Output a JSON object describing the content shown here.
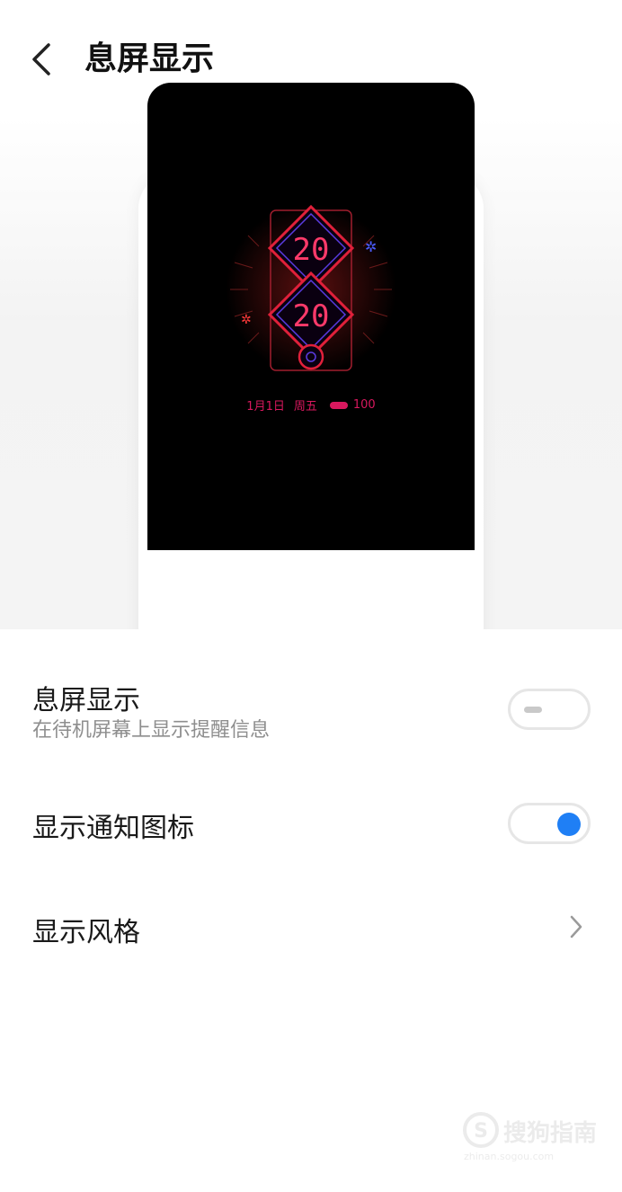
{
  "header": {
    "title": "息屏显示",
    "back_icon": "chevron-left-icon"
  },
  "preview": {
    "clock_year_top": "20",
    "clock_year_bottom": "20",
    "date": "1月1日",
    "weekday": "周五",
    "battery": "100",
    "accent_color": "#d8185e"
  },
  "settings": {
    "aod": {
      "title": "息屏显示",
      "subtitle": "在待机屏幕上显示提醒信息",
      "toggle_on": false
    },
    "notification_icons": {
      "title": "显示通知图标",
      "toggle_on": true
    },
    "display_style": {
      "title": "显示风格",
      "icon": "chevron-right-icon"
    }
  },
  "watermark": {
    "text": "搜狗指南",
    "url": "zhinan.sogou.com"
  },
  "colors": {
    "toggle_on": "#1f7ff5",
    "toggle_off_track": "#e6e6e6"
  }
}
